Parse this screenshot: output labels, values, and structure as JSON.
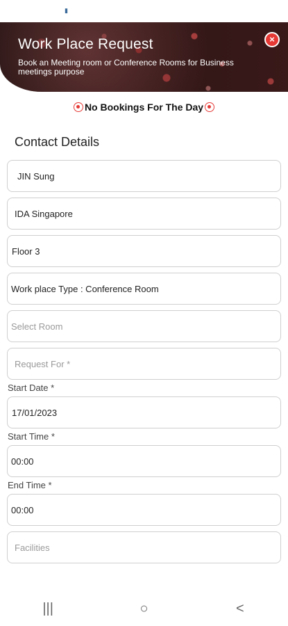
{
  "header": {
    "title": "Work Place Request",
    "subtitle": "Book an Meeting room or Conference Rooms for Business meetings purpose"
  },
  "notice": "No Bookings For The Day",
  "section_title": "Contact Details",
  "fields": {
    "name": "JIN Sung",
    "company": "IDA Singapore",
    "floor": "Floor 3",
    "workplace_type": "Work place Type : Conference Room",
    "room_placeholder": "Select Room",
    "request_for_placeholder": "Request For *",
    "start_date_label": "Start Date *",
    "start_date": "17/01/2023",
    "start_time_label": "Start Time *",
    "start_time": "00:00",
    "end_time_label": "End Time *",
    "end_time": "00:00",
    "facilities_placeholder": "Facilities"
  },
  "nav": {
    "recents": "|||",
    "home": "○",
    "back": "<"
  },
  "colors": {
    "accent": "#e53935"
  }
}
